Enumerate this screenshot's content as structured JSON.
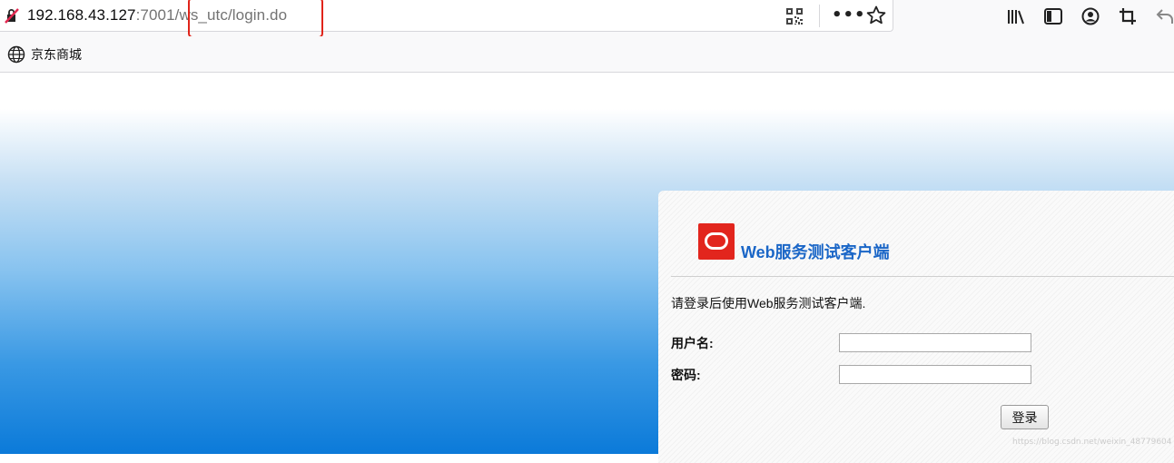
{
  "browser": {
    "url_host": "192.168.43.127",
    "url_path": ":7001/ws_utc/login.do",
    "more_label": "•••"
  },
  "bookmarks": [
    {
      "label": "京东商城",
      "icon": "globe-icon"
    }
  ],
  "login": {
    "brand_title": "Web服务测试客户端",
    "intro": "请登录后使用Web服务测试客户端.",
    "username_label": "用户名:",
    "password_label": "密码:",
    "username_value": "",
    "password_value": "",
    "submit_label": "登录"
  },
  "watermark": "https://blog.csdn.net/weixin_48779604",
  "colors": {
    "brand_red": "#e2251d",
    "brand_blue": "#1a66c7",
    "highlight": "#e0241a"
  }
}
